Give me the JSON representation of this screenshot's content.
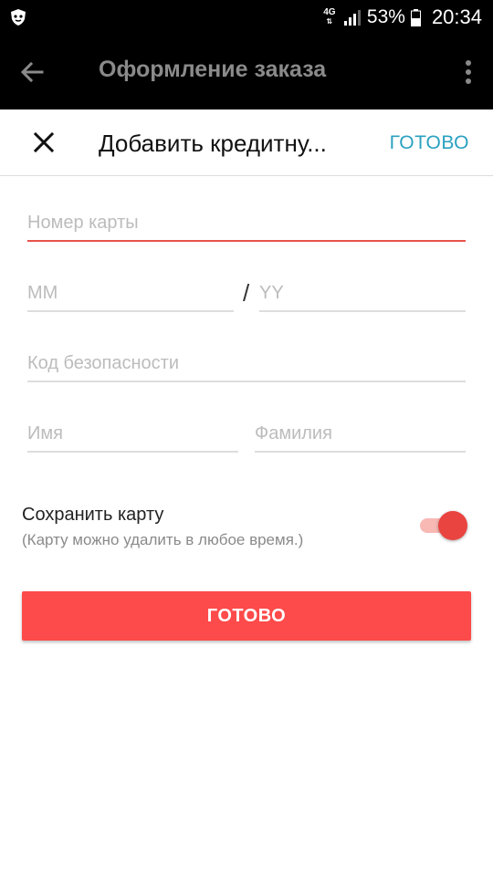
{
  "status_bar": {
    "network": "4G",
    "battery_percent": "53%",
    "time": "20:34"
  },
  "app_bar": {
    "title": "Оформление заказа",
    "back_icon": "arrow-left-icon",
    "menu_icon": "more-vert-icon"
  },
  "dialog": {
    "title": "Добавить кредитну...",
    "done_label": "ГОТОВО",
    "close_icon": "close-icon"
  },
  "form": {
    "card_number_placeholder": "Номер карты",
    "month_placeholder": "MM",
    "date_separator": "/",
    "year_placeholder": "YY",
    "security_code_placeholder": "Код безопасности",
    "first_name_placeholder": "Имя",
    "last_name_placeholder": "Фамилия"
  },
  "save_card": {
    "label": "Сохранить карту",
    "hint": "(Карту можно удалить в любое время.)",
    "enabled": true
  },
  "submit": {
    "label": "ГОТОВО"
  },
  "colors": {
    "accent_red": "#fd4a4a",
    "link_blue": "#2aa1c0",
    "active_underline": "#e8514a"
  }
}
